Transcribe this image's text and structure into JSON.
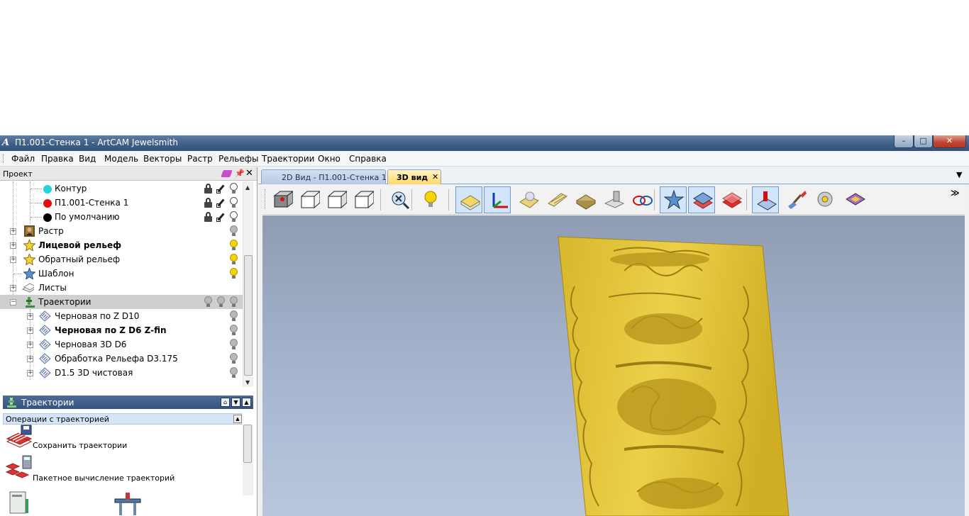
{
  "window": {
    "title": "П1.001-Стенка 1 - ArtCAM Jewelsmith",
    "icon_letter": "A",
    "controls": {
      "minimize": "–",
      "maximize": "□",
      "close": "✕"
    }
  },
  "menu": {
    "items": [
      "Файл",
      "Правка",
      "Вид",
      "Модель",
      "Векторы",
      "Растр",
      "Рельефы",
      "Траектории",
      "Окно",
      "Справка"
    ]
  },
  "project": {
    "title": "Проект",
    "pin": "ᵖ",
    "close": "✕",
    "layers": [
      {
        "label": "Контур",
        "color": "#22d3e0"
      },
      {
        "label": "П1.001-Стенка 1",
        "color": "#e01010"
      },
      {
        "label": "По умолчанию",
        "color": "#000000"
      }
    ],
    "nodes": [
      {
        "label": "Растр",
        "bold": false,
        "icon": "mona-lisa-icon",
        "bulb": "gray"
      },
      {
        "label": "Лицевой рельеф",
        "bold": true,
        "icon": "star-relief-icon",
        "bulb": "on"
      },
      {
        "label": "Обратный рельеф",
        "bold": false,
        "icon": "star-relief-icon",
        "bulb": "on"
      },
      {
        "label": "Шаблон",
        "bold": false,
        "icon": "template-star-icon",
        "bulb": "on"
      },
      {
        "label": "Листы",
        "bold": false,
        "icon": "sheets-icon",
        "bulb": "none"
      },
      {
        "label": "Траектории",
        "bold": false,
        "icon": "toolpath-machine-icon",
        "bulb": "gray3"
      }
    ],
    "toolpaths": [
      {
        "label": "Черновая по Z D10",
        "bold": false
      },
      {
        "label": "Черновая по Z D6 Z-fin",
        "bold": true
      },
      {
        "label": "Черновая 3D D6",
        "bold": false
      },
      {
        "label": "Обработка Рельефа D3.175",
        "bold": false
      },
      {
        "label": "D1.5 3D чистовая",
        "bold": false
      }
    ]
  },
  "toolpaths_panel": {
    "title": "Траектории",
    "section": "Операции с траекторией",
    "ops": [
      "Сохранить траектории",
      "Пакетное вычисление траекторий"
    ]
  },
  "view_tabs": [
    {
      "label": "2D Вид - П1.001-Стенка 1",
      "active": false
    },
    {
      "label": "3D вид",
      "active": true
    }
  ],
  "tab_close": "✕",
  "tab_dropdown": "▼",
  "toolbar_more": "≫",
  "toolbar": [
    {
      "name": "iso-view-icon",
      "pressed": false
    },
    {
      "name": "view-front-icon",
      "pressed": false
    },
    {
      "name": "view-side-icon",
      "pressed": false
    },
    {
      "name": "view-top-icon",
      "pressed": false
    },
    {
      "name": "zoom-fit-icon",
      "pressed": false
    },
    {
      "name": "light-bulb-icon",
      "pressed": false
    },
    {
      "name": "show-plane-icon",
      "pressed": true
    },
    {
      "name": "axes-icon",
      "pressed": true
    },
    {
      "name": "shade-relief-icon",
      "pressed": false
    },
    {
      "name": "wireframe-icon",
      "pressed": false
    },
    {
      "name": "material-block-icon",
      "pressed": false
    },
    {
      "name": "machine-sim-icon",
      "pressed": false
    },
    {
      "name": "blend-vectors-icon",
      "pressed": false
    },
    {
      "name": "star-relief-toggle-icon",
      "pressed": true
    },
    {
      "name": "layers-toggle-icon",
      "pressed": true
    },
    {
      "name": "red-layer-icon",
      "pressed": false
    },
    {
      "name": "toolpath-preview-icon",
      "pressed": true
    },
    {
      "name": "paint-brush-icon",
      "pressed": false
    },
    {
      "name": "gear-settings-icon",
      "pressed": false
    },
    {
      "name": "diamond-icon",
      "pressed": false
    }
  ],
  "colors": {
    "relief": "#e3c23a",
    "relief_dark": "#a78516",
    "viewport_top": "#8f9cb3",
    "viewport_bottom": "#b9c6dc",
    "titlebar": "#3f5f88"
  }
}
